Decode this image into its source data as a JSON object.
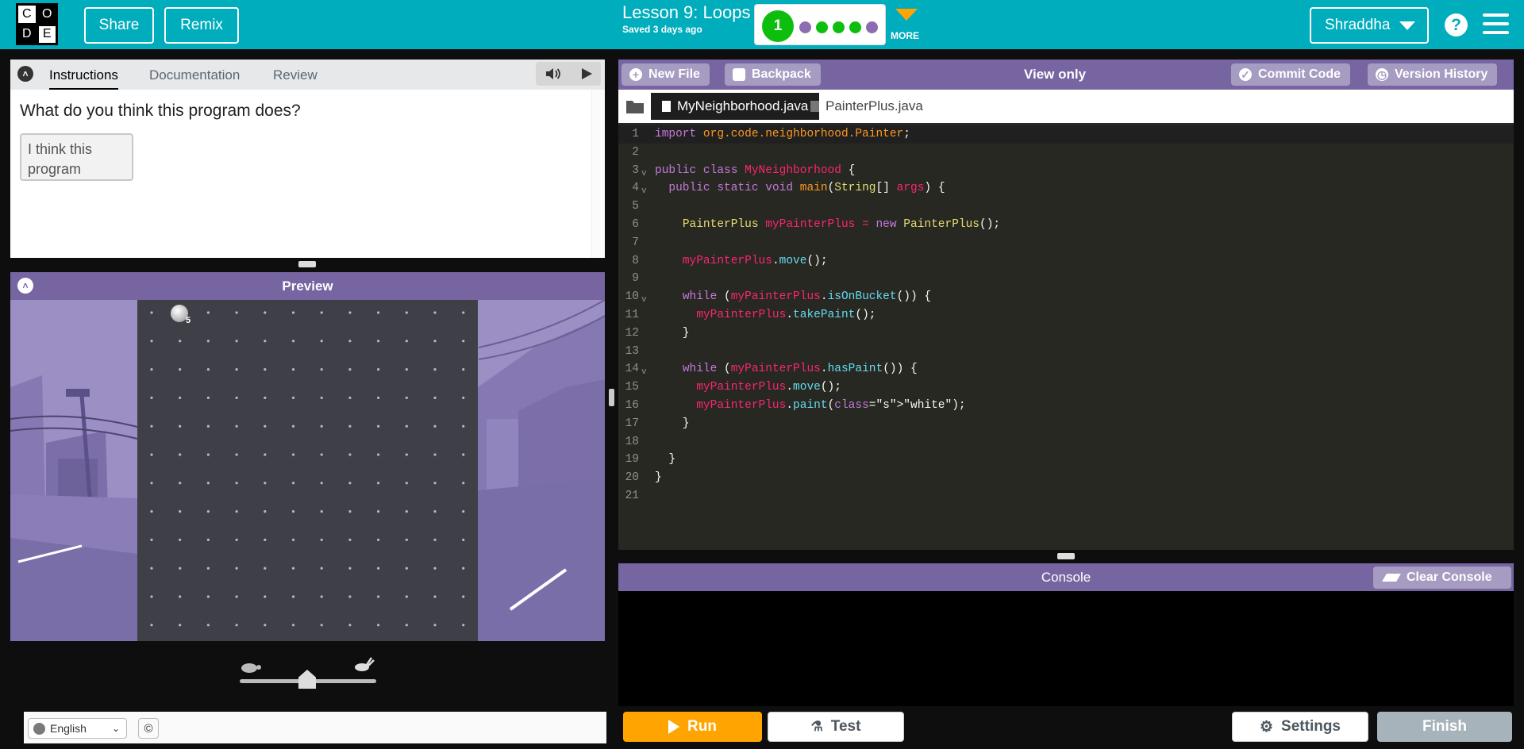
{
  "header": {
    "logo_letters": [
      "C",
      "O",
      "D",
      "E"
    ],
    "share_label": "Share",
    "remix_label": "Remix",
    "lesson_title": "Lesson 9: Loops",
    "saved_text": "Saved 3 days ago",
    "current_level": "1",
    "level_dots": [
      {
        "color": "#8c6db0"
      },
      {
        "color": "#0ebe0e"
      },
      {
        "color": "#0ebe0e"
      },
      {
        "color": "#0ebe0e"
      },
      {
        "color": "#8c6db0"
      }
    ],
    "more_label": "MORE",
    "user_name": "Shraddha",
    "help_icon": "?",
    "accent_color": "#00adbc"
  },
  "instructions": {
    "tabs": [
      {
        "label": "Instructions",
        "active": true
      },
      {
        "label": "Documentation",
        "active": false
      },
      {
        "label": "Review",
        "active": false
      }
    ],
    "question": "What do you think this program does?",
    "answer_text": "I think this program"
  },
  "preview": {
    "title": "Preview",
    "painter_count": "5",
    "header_color": "#7665a0"
  },
  "editor": {
    "new_file_label": "New File",
    "backpack_label": "Backpack",
    "view_only_label": "View only",
    "commit_label": "Commit Code",
    "version_history_label": "Version History",
    "files": [
      {
        "name": "MyNeighborhood.java",
        "active": true
      },
      {
        "name": "PainterPlus.java",
        "active": false
      }
    ],
    "code_lines": [
      {
        "n": "1",
        "fold": false
      },
      {
        "n": "2",
        "fold": false
      },
      {
        "n": "3",
        "fold": true
      },
      {
        "n": "4",
        "fold": true
      },
      {
        "n": "5",
        "fold": false
      },
      {
        "n": "6",
        "fold": false
      },
      {
        "n": "7",
        "fold": false
      },
      {
        "n": "8",
        "fold": false
      },
      {
        "n": "9",
        "fold": false
      },
      {
        "n": "10",
        "fold": true
      },
      {
        "n": "11",
        "fold": false
      },
      {
        "n": "12",
        "fold": false
      },
      {
        "n": "13",
        "fold": false
      },
      {
        "n": "14",
        "fold": true
      },
      {
        "n": "15",
        "fold": false
      },
      {
        "n": "16",
        "fold": false
      },
      {
        "n": "17",
        "fold": false
      },
      {
        "n": "18",
        "fold": false
      },
      {
        "n": "19",
        "fold": false
      },
      {
        "n": "20",
        "fold": false
      },
      {
        "n": "21",
        "fold": false
      }
    ],
    "code_text": [
      "import org.code.neighborhood.Painter;",
      "",
      "public class MyNeighborhood {",
      "  public static void main(String[] args) {",
      "",
      "    PainterPlus myPainterPlus = new PainterPlus();",
      "",
      "    myPainterPlus.move();",
      "",
      "    while (myPainterPlus.isOnBucket()) {",
      "      myPainterPlus.takePaint();",
      "    }",
      "",
      "    while (myPainterPlus.hasPaint()) {",
      "      myPainterPlus.move();",
      "      myPainterPlus.paint(\"white\");",
      "    }",
      "",
      "  }",
      "}",
      ""
    ]
  },
  "console": {
    "title": "Console",
    "clear_label": "Clear Console"
  },
  "footer": {
    "language": "English",
    "copyright_icon": "©",
    "run_label": "Run",
    "test_label": "Test",
    "settings_label": "Settings",
    "finish_label": "Finish",
    "run_color": "#ffa400"
  }
}
